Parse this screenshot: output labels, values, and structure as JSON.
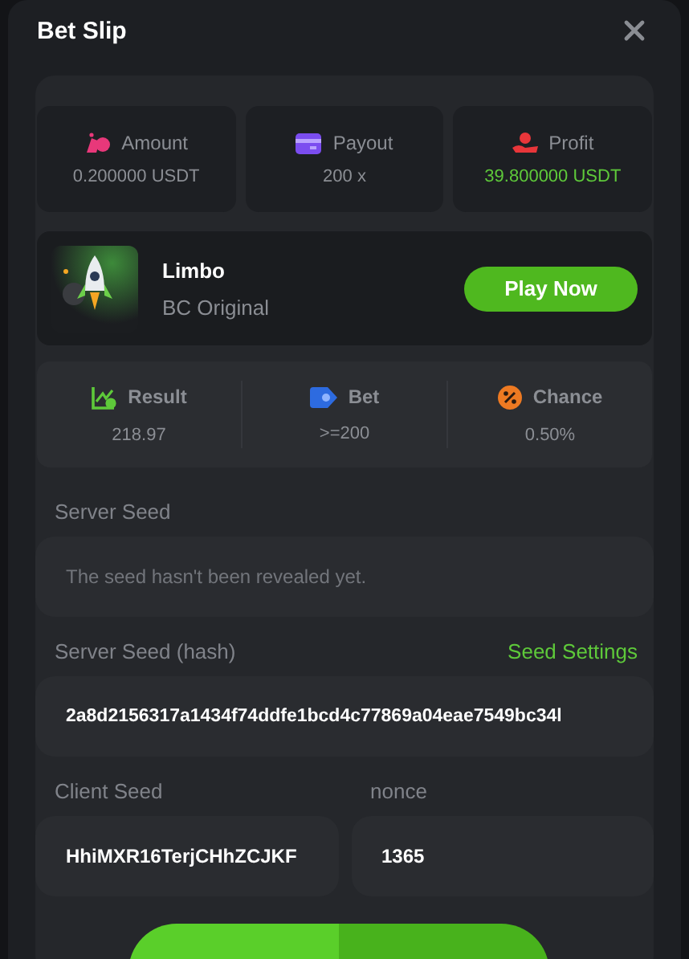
{
  "dialog": {
    "title": "Bet Slip"
  },
  "stats": [
    {
      "kind": "amount",
      "label": "Amount",
      "value": "0.200000 USDT",
      "positive": false
    },
    {
      "kind": "payout",
      "label": "Payout",
      "value": "200 x",
      "positive": false
    },
    {
      "kind": "profit",
      "label": "Profit",
      "value": "39.800000 USDT",
      "positive": true
    }
  ],
  "game": {
    "name": "Limbo",
    "provider": "BC Original",
    "play_button": "Play Now"
  },
  "details": [
    {
      "kind": "result",
      "label": "Result",
      "value": "218.97"
    },
    {
      "kind": "bet",
      "label": "Bet",
      "value": ">=200"
    },
    {
      "kind": "chance",
      "label": "Chance",
      "value": "0.50%"
    }
  ],
  "server_seed": {
    "label": "Server Seed",
    "placeholder": "The seed hasn't been revealed yet."
  },
  "server_seed_hash": {
    "label": "Server Seed (hash)",
    "link": "Seed Settings",
    "value": "2a8d2156317a1434f74ddfe1bcd4c77869a04eae7549bc34l"
  },
  "client_seed": {
    "label": "Client Seed",
    "value": "HhiMXR16TerjCHhZCJKF"
  },
  "nonce": {
    "label": "nonce",
    "value": "1365"
  }
}
